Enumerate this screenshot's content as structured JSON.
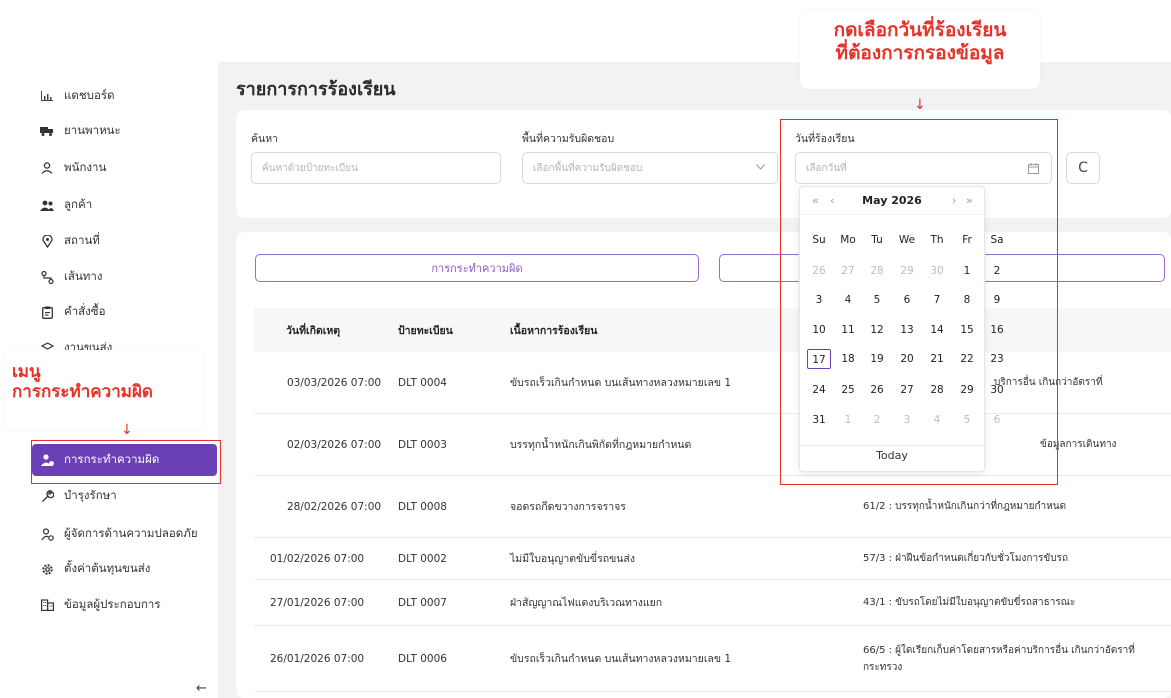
{
  "sidebar": {
    "items": [
      {
        "label": "แดชบอร์ด",
        "icon": "chart-icon"
      },
      {
        "label": "ยานพาหนะ",
        "icon": "truck-icon"
      },
      {
        "label": "พนักงาน",
        "icon": "user-icon"
      },
      {
        "label": "ลูกค้า",
        "icon": "users-icon"
      },
      {
        "label": "สถานที่",
        "icon": "location-pin-icon"
      },
      {
        "label": "เส้นทาง",
        "icon": "route-icon"
      },
      {
        "label": "คำสั่งซื้อ",
        "icon": "clipboard-icon"
      },
      {
        "label": "งานขนส่ง",
        "icon": "cube-icon"
      },
      {
        "label": "การกระทำความผิด",
        "icon": "user-warning-icon"
      },
      {
        "label": "บำรุงรักษา",
        "icon": "wrench-icon"
      },
      {
        "label": "ผู้จัดการด้านความปลอดภัย",
        "icon": "user-shield-icon"
      },
      {
        "label": "ตั้งค่าต้นทุนขนส่ง",
        "icon": "gear-icon"
      },
      {
        "label": "ข้อมูลผู้ประกอบการ",
        "icon": "building-icon"
      }
    ],
    "collapse": "←"
  },
  "page": {
    "title": "รายการการร้องเรียน"
  },
  "filters": {
    "search_label": "ค้นหา",
    "search_placeholder": "ค้นหาด้วยป้ายทะเบียน",
    "area_label": "พื้นที่ความรับผิดชอบ",
    "area_placeholder": "เลือกพื้นที่ความรับผิดชอบ",
    "date_label": "วันที่ร้องเรียน",
    "date_placeholder": "เลือกวันที่",
    "refresh": "C"
  },
  "tabs": [
    {
      "label": "การกระทำความผิด"
    },
    {
      "label": ""
    }
  ],
  "table": {
    "headers": [
      "วันที่เกิดเหตุ",
      "ป้ายทะเบียน",
      "เนื้อหาการร้องเรียน"
    ],
    "rows": [
      {
        "date": "03/03/2026 07:00",
        "plate": "DLT 0004",
        "content": "ขับรถเร็วเกินกำหนด บนเส้นทางหลวงหมายเลข 1",
        "violation": "บริการอื่น เกินกว่าอัตราที่"
      },
      {
        "date": "02/03/2026 07:00",
        "plate": "DLT 0003",
        "content": "บรรทุกน้ำหนักเกินพิกัดที่กฎหมายกำหนด",
        "violation": "ข้อมูลการเดินทาง"
      },
      {
        "date": "28/02/2026 07:00",
        "plate": "DLT 0008",
        "content": "จอดรถกีดขวางการจราจร",
        "violation": "61/2 : บรรทุกน้ำหนักเกินกว่าที่กฎหมายกำหนด"
      },
      {
        "date": "01/02/2026 07:00",
        "plate": "DLT 0002",
        "content": "ไม่มีใบอนุญาตขับขี่รถขนส่ง",
        "violation": "57/3 : ฝ่าฝืนข้อกำหนดเกี่ยวกับชั่วโมงการขับรถ"
      },
      {
        "date": "27/01/2026 07:00",
        "plate": "DLT 0007",
        "content": "ฝ่าสัญญาณไฟแดงบริเวณทางแยก",
        "violation": "43/1 : ขับรถโดยไม่มีใบอนุญาตขับขี่รถสาธารณะ"
      },
      {
        "date": "26/01/2026 07:00",
        "plate": "DLT 0006",
        "content": "ขับรถเร็วเกินกำหนด บนเส้นทางหลวงหมายเลข 1",
        "violation": "66/5 : ผู้ใดเรียกเก็บค่าโดยสารหรือค่าบริการอื่น เกินกว่าอัตราที่ กระทรวง"
      }
    ]
  },
  "datepicker": {
    "month_title": "May  2026",
    "prev_year": "«",
    "prev_month": "‹",
    "next_month": "›",
    "next_year": "»",
    "weekdays": [
      "Su",
      "Mo",
      "Tu",
      "We",
      "Th",
      "Fr",
      "Sa"
    ],
    "weeks": [
      [
        "26",
        "27",
        "28",
        "29",
        "30",
        "1",
        "2"
      ],
      [
        "3",
        "4",
        "5",
        "6",
        "7",
        "8",
        "9"
      ],
      [
        "10",
        "11",
        "12",
        "13",
        "14",
        "15",
        "16"
      ],
      [
        "17",
        "18",
        "19",
        "20",
        "21",
        "22",
        "23"
      ],
      [
        "24",
        "25",
        "26",
        "27",
        "28",
        "29",
        "30"
      ],
      [
        "31",
        "1",
        "2",
        "3",
        "4",
        "5",
        "6"
      ]
    ],
    "today_label": "Today",
    "today_value": "17"
  },
  "annotations": {
    "callout_date": [
      "กดเลือกวันที่ร้องเรียน",
      "ที่ต้องการกรองข้อมูล"
    ],
    "callout_menu": [
      "เมนู",
      "การกระทำความผิด"
    ],
    "arrow": "↓",
    "color": "#e5332a"
  },
  "colors": {
    "accent": "#6b3fb5",
    "tab_border": "#9a6ad0"
  }
}
